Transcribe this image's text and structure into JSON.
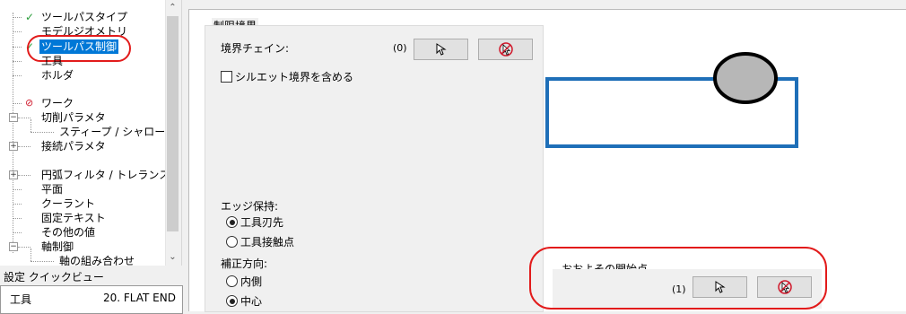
{
  "tree": {
    "items": [
      {
        "label": "ツールパスタイプ",
        "mark": "check"
      },
      {
        "label": "モデルジオメトリ",
        "mark": ""
      },
      {
        "label": "ツールパス制御",
        "mark": "check",
        "selected": true
      },
      {
        "label": "工具",
        "mark": ""
      },
      {
        "label": "ホルダ",
        "mark": ""
      },
      {
        "label": "ワーク",
        "mark": "prohibit"
      },
      {
        "label": "切削パラメタ",
        "mark": ""
      },
      {
        "label": "スティープ / シャロー",
        "mark": ""
      },
      {
        "label": "接続パラメタ",
        "mark": ""
      },
      {
        "label": "円弧フィルタ / トレランス",
        "mark": ""
      },
      {
        "label": "平面",
        "mark": ""
      },
      {
        "label": "クーラント",
        "mark": ""
      },
      {
        "label": "固定テキスト",
        "mark": ""
      },
      {
        "label": "その他の値",
        "mark": ""
      },
      {
        "label": "軸制御",
        "mark": ""
      },
      {
        "label": "軸の組み合わせ",
        "mark": ""
      }
    ]
  },
  "quickview": {
    "title": "設定 クイックビュー",
    "rows": [
      {
        "key": "工具",
        "value": "20. FLAT END"
      }
    ]
  },
  "boundary": {
    "group_title": "制限境界",
    "chain_label": "境界チェイン:",
    "chain_count": "(0)",
    "silhouette_label": "シルエット境界を含める",
    "edge_label": "エッジ保持:",
    "edge_options": [
      "工具刃先",
      "工具接触点"
    ],
    "comp_label": "補正方向:",
    "comp_options": [
      "内側",
      "中心"
    ]
  },
  "start": {
    "label": "おおよその開始点",
    "count": "(1)"
  },
  "colors": {
    "highlight": "#e21b1b",
    "selection": "#0078d7",
    "preview_rect": "#1e6fb8"
  }
}
